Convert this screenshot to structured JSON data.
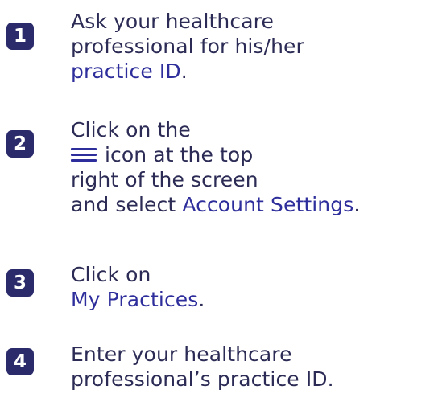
{
  "colors": {
    "badge": "#2b2b6b",
    "text": "#2b2b55",
    "highlight": "#2d2d9b",
    "menu_icon": "#2d2d9b"
  },
  "steps": [
    {
      "number": "1",
      "line1": "Ask your healthcare",
      "line2": "professional for his/her",
      "highlight": "practice ID",
      "suffix": "."
    },
    {
      "number": "2",
      "line1": "Click on the",
      "icon": "hamburger-menu-icon",
      "line2_after_icon": "icon at the top",
      "line3": "right of the screen",
      "line4_prefix": "and select ",
      "highlight": "Account Settings",
      "suffix": "."
    },
    {
      "number": "3",
      "line1": "Click on",
      "highlight": "My Practices",
      "suffix": "."
    },
    {
      "number": "4",
      "line1": "Enter your healthcare",
      "line2": "professional’s practice ID."
    }
  ]
}
